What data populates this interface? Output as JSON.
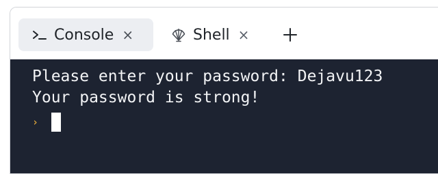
{
  "tabs": [
    {
      "label": "Console",
      "icon": "terminal-icon",
      "close": "×",
      "active": true
    },
    {
      "label": "Shell",
      "icon": "shell-icon",
      "close": "×",
      "active": false
    }
  ],
  "new_tab": {
    "icon": "plus-icon"
  },
  "terminal": {
    "lines": [
      "Please enter your password: Dejavu123",
      "Your password is strong!"
    ],
    "prompt_symbol": "›",
    "prompt_color": "#d7a23a",
    "background": "#1d2331"
  }
}
